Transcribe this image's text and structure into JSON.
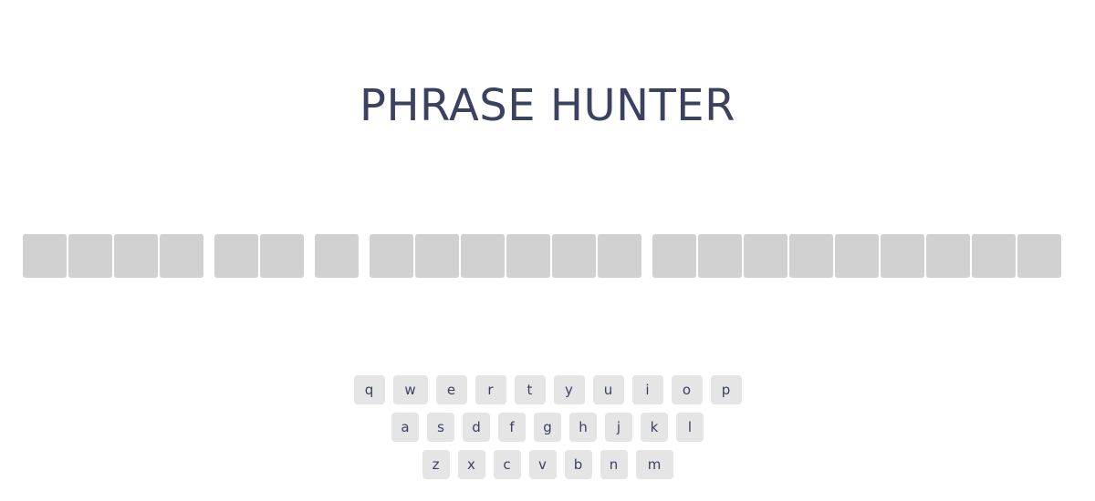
{
  "header": {
    "title": "PHRASE HUNTER"
  },
  "phrase": {
    "word_lengths": [
      4,
      2,
      1,
      6,
      9
    ],
    "revealed_letters": []
  },
  "keyboard": {
    "rows": [
      [
        "q",
        "w",
        "e",
        "r",
        "t",
        "y",
        "u",
        "i",
        "o",
        "p"
      ],
      [
        "a",
        "s",
        "d",
        "f",
        "g",
        "h",
        "j",
        "k",
        "l"
      ],
      [
        "z",
        "x",
        "c",
        "v",
        "b",
        "n",
        "m"
      ]
    ]
  },
  "colors": {
    "title": "#3b4260",
    "tile": "#d1d1d1",
    "key_bg": "#e5e5e5",
    "key_text": "#3b4260"
  }
}
